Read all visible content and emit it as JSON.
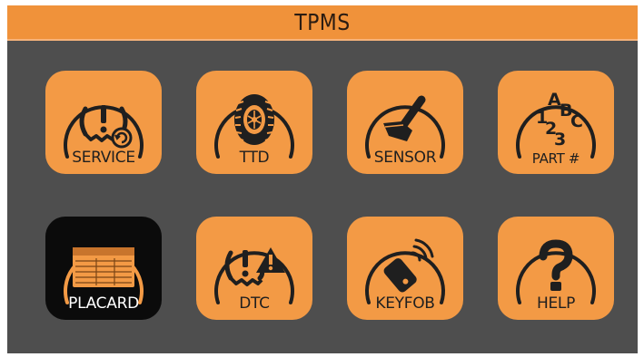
{
  "app": {
    "title": "TPMS"
  },
  "colors": {
    "accent": "#f39a45",
    "background": "#4e4e4e",
    "selected_tile": "#0b0b0b"
  },
  "tiles": [
    {
      "label": "SERVICE",
      "icon": "tire-pressure-service-icon",
      "selected": false
    },
    {
      "label": "TTD",
      "icon": "tire-icon",
      "selected": false
    },
    {
      "label": "SENSOR",
      "icon": "valve-sensor-icon",
      "selected": false
    },
    {
      "label": "PART #",
      "icon": "abc-123-icon",
      "selected": false
    },
    {
      "label": "PLACARD",
      "icon": "placard-icon",
      "selected": true
    },
    {
      "label": "DTC",
      "icon": "tpms-warning-icon",
      "selected": false
    },
    {
      "label": "KEYFOB",
      "icon": "keyfob-icon",
      "selected": false
    },
    {
      "label": "HELP",
      "icon": "question-mark-icon",
      "selected": false
    }
  ]
}
